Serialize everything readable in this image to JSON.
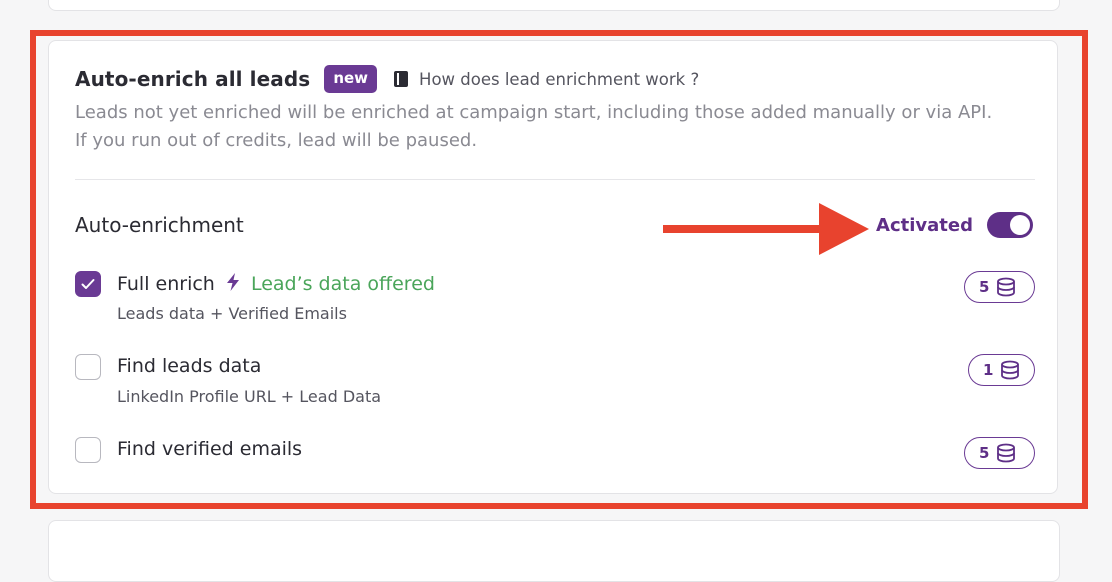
{
  "section": {
    "title": "Auto-enrich all leads",
    "badge": "new",
    "help_link": "How does lead enrichment work ?",
    "description_line1": "Leads not yet enriched will be enriched at campaign start, including those added manually or via API.",
    "description_line2": "If you run out of credits, lead will be paused."
  },
  "auto_enrichment": {
    "label": "Auto-enrichment",
    "status": "Activated",
    "enabled": true
  },
  "options": [
    {
      "label": "Full enrich",
      "offer": "Lead’s data offered",
      "sub": "Leads data + Verified Emails",
      "credits": "5",
      "checked": true
    },
    {
      "label": "Find leads data",
      "sub": "LinkedIn Profile URL + Lead Data",
      "credits": "1",
      "checked": false
    },
    {
      "label": "Find verified emails",
      "credits": "5",
      "checked": false
    }
  ],
  "icons": {
    "help": "book-icon",
    "offer": "lightning-bolt-icon",
    "credits": "database-coin-icon",
    "annotation": "red-arrow"
  },
  "colors": {
    "accent": "#6a3a94",
    "offer_green": "#4aa55a",
    "highlight_red": "#e8432e"
  }
}
